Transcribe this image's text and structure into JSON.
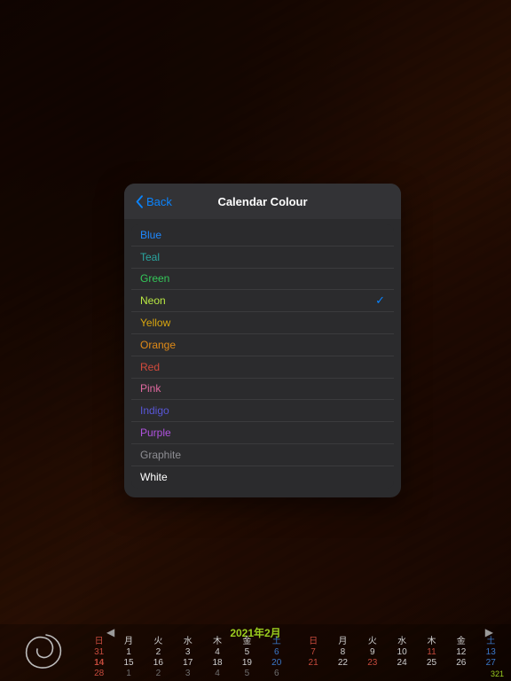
{
  "popover": {
    "title": "Calendar Colour",
    "back_label": "Back",
    "colours": [
      {
        "label": "Blue",
        "text": "#1e88ff",
        "selected": false
      },
      {
        "label": "Teal",
        "text": "#2aa6a0",
        "selected": false
      },
      {
        "label": "Green",
        "text": "#34c759",
        "selected": false
      },
      {
        "label": "Neon",
        "text": "#b9e843",
        "selected": true
      },
      {
        "label": "Yellow",
        "text": "#d9a60f",
        "selected": false
      },
      {
        "label": "Orange",
        "text": "#e08a17",
        "selected": false
      },
      {
        "label": "Red",
        "text": "#d24a3c",
        "selected": false
      },
      {
        "label": "Pink",
        "text": "#e069a0",
        "selected": false
      },
      {
        "label": "Indigo",
        "text": "#5856d6",
        "selected": false
      },
      {
        "label": "Purple",
        "text": "#af52de",
        "selected": false
      },
      {
        "label": "Graphite",
        "text": "#8e8e93",
        "selected": false
      },
      {
        "label": "White",
        "text": "#ffffff",
        "selected": false
      }
    ],
    "check_glyph": "✓",
    "accent": "#0a84ff"
  },
  "calendar": {
    "title": "2021年2月",
    "prev_glyph": "◀",
    "next_glyph": "▶",
    "today_colour": "#9acd1f",
    "dow": [
      "日",
      "月",
      "火",
      "水",
      "木",
      "金",
      "土"
    ],
    "weeks_left": [
      [
        {
          "d": "31",
          "cls": "sun dim2"
        },
        {
          "d": "1"
        },
        {
          "d": "2"
        },
        {
          "d": "3"
        },
        {
          "d": "4"
        },
        {
          "d": "5"
        },
        {
          "d": "6",
          "cls": "sat"
        }
      ],
      [
        {
          "d": "14",
          "cls": "sun today"
        },
        {
          "d": "15"
        },
        {
          "d": "16"
        },
        {
          "d": "17"
        },
        {
          "d": "18"
        },
        {
          "d": "19"
        },
        {
          "d": "20",
          "cls": "sat"
        }
      ],
      [
        {
          "d": "28",
          "cls": "sun"
        },
        {
          "d": "1",
          "cls": "dim2"
        },
        {
          "d": "2",
          "cls": "dim2"
        },
        {
          "d": "3",
          "cls": "dim2"
        },
        {
          "d": "4",
          "cls": "dim2"
        },
        {
          "d": "5",
          "cls": "dim2"
        },
        {
          "d": "6",
          "cls": "dim2"
        }
      ]
    ],
    "weeks_right": [
      [
        {
          "d": "7",
          "cls": "sun"
        },
        {
          "d": "8"
        },
        {
          "d": "9"
        },
        {
          "d": "10"
        },
        {
          "d": "11",
          "cls": "hol"
        },
        {
          "d": "12"
        },
        {
          "d": "13",
          "cls": "sat"
        }
      ],
      [
        {
          "d": "21",
          "cls": "sun"
        },
        {
          "d": "22"
        },
        {
          "d": "23",
          "cls": "hol"
        },
        {
          "d": "24"
        },
        {
          "d": "25"
        },
        {
          "d": "26"
        },
        {
          "d": "27",
          "cls": "sat"
        }
      ],
      [
        {
          "d": "",
          "cls": ""
        },
        {
          "d": "",
          "cls": ""
        },
        {
          "d": "",
          "cls": ""
        },
        {
          "d": "",
          "cls": ""
        },
        {
          "d": "",
          "cls": ""
        },
        {
          "d": "",
          "cls": ""
        },
        {
          "d": "321",
          "cls": "wk"
        }
      ]
    ]
  }
}
